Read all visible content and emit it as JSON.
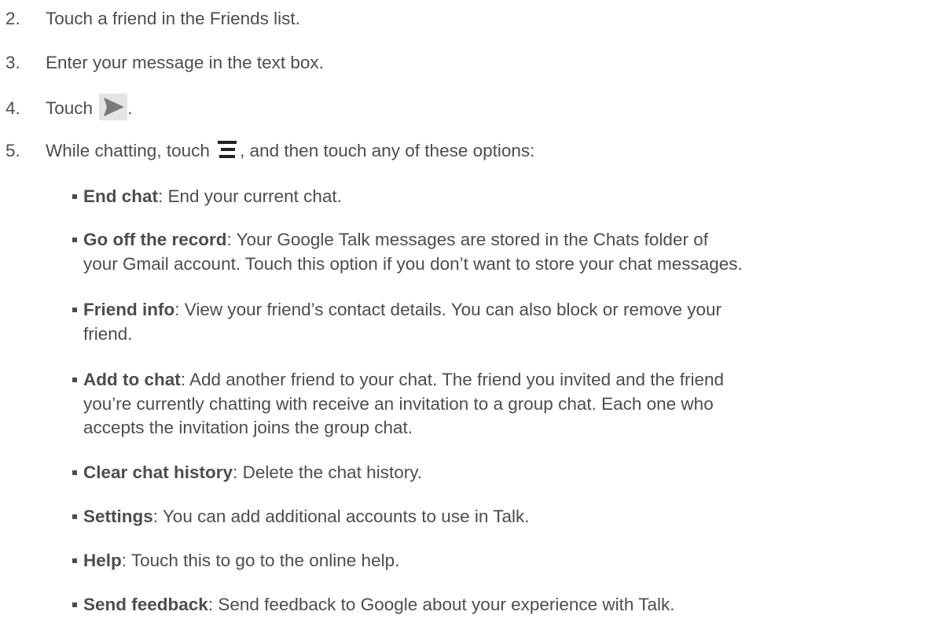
{
  "steps": [
    {
      "num": "2.",
      "text": "Touch a friend in the Friends list."
    },
    {
      "num": "3.",
      "text": "Enter your message in the text box."
    },
    {
      "num": "4.",
      "before": "Touch ",
      "icon": "send-arrow-icon",
      "after": "."
    },
    {
      "num": "5.",
      "before": "While chatting, touch ",
      "icon": "menu-icon",
      "after": ", and then touch any of these options:"
    }
  ],
  "options": [
    {
      "term": "End chat",
      "desc": ": End your current chat."
    },
    {
      "term": "Go off the record",
      "desc": ": Your Google Talk messages are stored in the Chats folder of",
      "desc2": "your Gmail account. Touch this option if you don’t want to store your chat messages."
    },
    {
      "term": "Friend info",
      "desc": ": View your friend’s contact details. You can also block or remove your",
      "desc2": "friend."
    },
    {
      "term": "Add to chat",
      "desc": ": Add another friend to your chat. The friend you invited and the friend",
      "desc2": "you’re currently chatting with receive an invitation to a group chat. Each one who",
      "desc3": "accepts the invitation joins the group chat."
    },
    {
      "term": "Clear chat history",
      "desc": ": Delete the chat history."
    },
    {
      "term": "Settings",
      "desc": ": You can add additional accounts to use in Talk."
    },
    {
      "term": "Help",
      "desc": ": Touch this to go to the online help."
    },
    {
      "term": "Send feedback",
      "desc": ": Send feedback to Google about your experience with Talk."
    }
  ],
  "colors": {
    "text": "#4d4d4d",
    "icon_bg": "#e4e4e4",
    "icon_fg": "#7a7a7a",
    "menu_icon": "#222222"
  }
}
